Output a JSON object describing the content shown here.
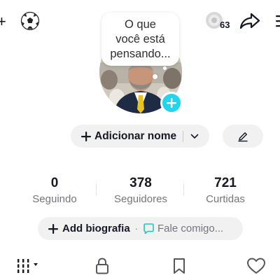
{
  "header": {
    "add_icon": "plus-icon",
    "sport_icon": "soccer-ball-icon",
    "coins_icon": "coin-icon",
    "coins_count": "63",
    "share_icon": "share-arrow-icon",
    "menu_icon": "hamburger-menu-icon"
  },
  "profile": {
    "bubble_line1": "O que",
    "bubble_line2": "você está",
    "bubble_line3": "pensando...",
    "avatar_add_icon": "plus-icon"
  },
  "name_row": {
    "add_name_label": "Adicionar nome",
    "edit_icon": "pencil-icon"
  },
  "stats": [
    {
      "value": "0",
      "label": "Seguindo"
    },
    {
      "value": "378",
      "label": "Seguidores"
    },
    {
      "value": "721",
      "label": "Curtidas"
    }
  ],
  "bio": {
    "add_label": "Add biografia",
    "separator": "·",
    "chat_placeholder": "Fale comigo..."
  },
  "tabs": [
    {
      "icon": "videos-grid-icon",
      "selected": true
    },
    {
      "icon": "lock-icon",
      "selected": false
    },
    {
      "icon": "bookmark-icon",
      "selected": false
    },
    {
      "icon": "heart-icon",
      "selected": false
    }
  ],
  "colors": {
    "accent": "#20d5ec",
    "chat_icon": "#26c6b4",
    "pill_bg": "#f1f1f2",
    "secondary_text": "#75757d"
  }
}
